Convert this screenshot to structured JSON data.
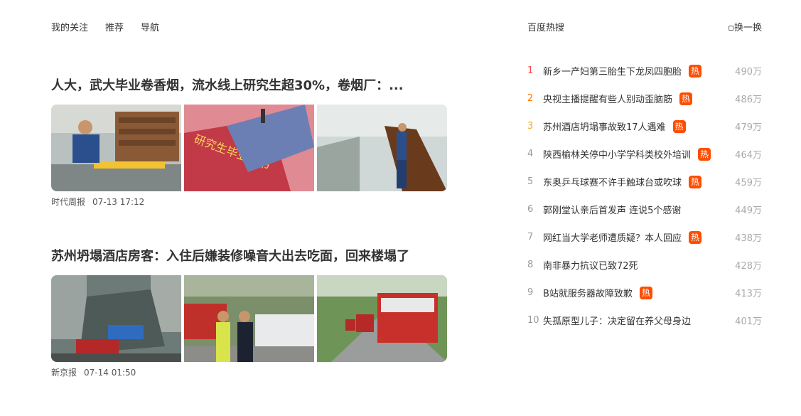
{
  "nav": {
    "tabs": [
      "我的关注",
      "推荐",
      "导航"
    ]
  },
  "feed": [
    {
      "title": "人大，武大毕业卷香烟，流水线上研究生超30%，卷烟厂：...",
      "source": "时代周报",
      "time": "07-13 17:12",
      "images": [
        "factory-worker-photo",
        "graduate-certificate-photo",
        "production-line-photo"
      ]
    },
    {
      "title": "苏州坍塌酒店房客：入住后嫌装修噪音大出去吃面，回来楼塌了",
      "source": "新京报",
      "time": "07-14 01:50",
      "images": [
        "collapse-site-photo",
        "police-scene-photo",
        "fire-trucks-street-photo"
      ]
    }
  ],
  "hot": {
    "title": "百度热搜",
    "refresh": "换一换",
    "badge": "热",
    "items": [
      {
        "rank": "1",
        "text": "新乡一产妇第三胎生下龙凤四胞胎",
        "hot": true,
        "count": "490万"
      },
      {
        "rank": "2",
        "text": "央视主播提醒有些人别动歪脑筋",
        "hot": true,
        "count": "486万"
      },
      {
        "rank": "3",
        "text": "苏州酒店坍塌事故致17人遇难",
        "hot": true,
        "count": "479万"
      },
      {
        "rank": "4",
        "text": "陕西榆林关停中小学学科类校外培训",
        "hot": true,
        "count": "464万"
      },
      {
        "rank": "5",
        "text": "东奥乒乓球赛不许手触球台或吹球",
        "hot": true,
        "count": "459万"
      },
      {
        "rank": "6",
        "text": "郭刚堂认亲后首发声 连说5个感谢",
        "hot": false,
        "count": "449万"
      },
      {
        "rank": "7",
        "text": "网红当大学老师遭质疑？本人回应",
        "hot": true,
        "count": "438万"
      },
      {
        "rank": "8",
        "text": "南非暴力抗议已致72死",
        "hot": false,
        "count": "428万"
      },
      {
        "rank": "9",
        "text": "B站就服务器故障致歉",
        "hot": true,
        "count": "413万"
      },
      {
        "rank": "10",
        "text": "失孤原型儿子：决定留在养父母身边",
        "hot": false,
        "count": "401万"
      }
    ]
  }
}
